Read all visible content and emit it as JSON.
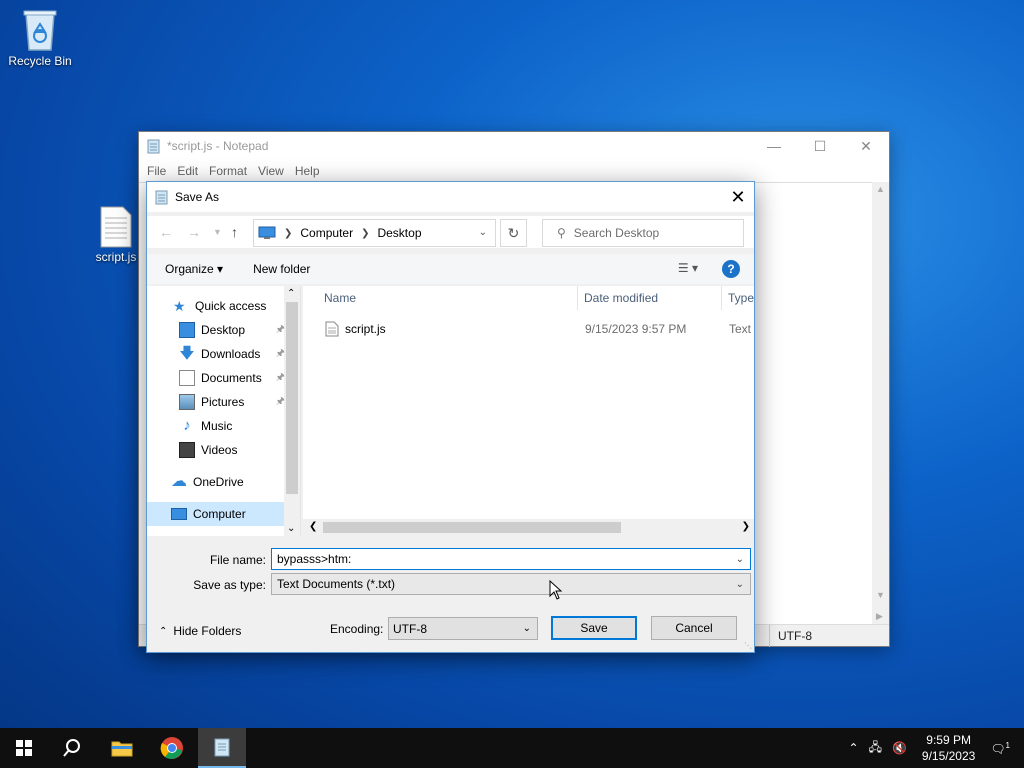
{
  "desktop": {
    "icons": [
      {
        "label": "Recycle Bin"
      },
      {
        "label": "script.js"
      }
    ]
  },
  "notepad": {
    "title": "*script.js - Notepad",
    "menu": [
      "File",
      "Edit",
      "Format",
      "View",
      "Help"
    ],
    "status_encoding": "UTF-8"
  },
  "dialog": {
    "title": "Save As",
    "breadcrumb": [
      "Computer",
      "Desktop"
    ],
    "search_placeholder": "Search Desktop",
    "organize": "Organize",
    "new_folder": "New folder",
    "nav": {
      "quick_access": "Quick access",
      "items": [
        {
          "label": "Desktop",
          "pinned": true
        },
        {
          "label": "Downloads",
          "pinned": true
        },
        {
          "label": "Documents",
          "pinned": true
        },
        {
          "label": "Pictures",
          "pinned": true
        },
        {
          "label": "Music",
          "pinned": false
        },
        {
          "label": "Videos",
          "pinned": false
        }
      ],
      "onedrive": "OneDrive",
      "computer": "Computer"
    },
    "columns": {
      "name": "Name",
      "date": "Date modified",
      "type": "Type"
    },
    "files": [
      {
        "name": "script.js",
        "date": "9/15/2023 9:57 PM",
        "type": "Text D"
      }
    ],
    "file_name_label": "File name:",
    "file_name_value": "bypasss>htm:",
    "save_type_label": "Save as type:",
    "save_type_value": "Text Documents (*.txt)",
    "hide_folders": "Hide Folders",
    "encoding_label": "Encoding:",
    "encoding_value": "UTF-8",
    "save": "Save",
    "cancel": "Cancel"
  },
  "taskbar": {
    "time": "9:59 PM",
    "date": "9/15/2023",
    "notification_count": "1"
  },
  "colors": {
    "accent": "#0078d7",
    "selection": "#cce8ff"
  }
}
